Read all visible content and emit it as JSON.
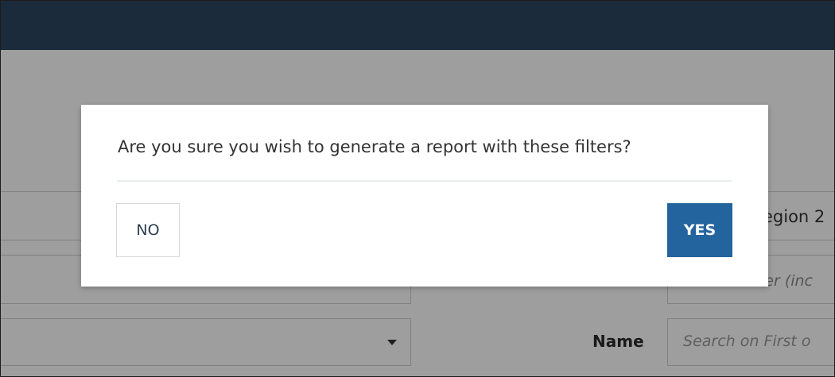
{
  "background_page": {
    "region_text": "egion 2",
    "select_user_placeholder": "Select a user (inc",
    "name_label": "Name",
    "name_search_placeholder": "Search on First o"
  },
  "dialog": {
    "message": "Are you sure you wish to generate a report with these filters?",
    "no_label": "NO",
    "yes_label": "YES"
  },
  "colors": {
    "header": "#2c4660",
    "primary_button": "#23649e",
    "overlay": "rgba(0,0,0,0.38)"
  }
}
